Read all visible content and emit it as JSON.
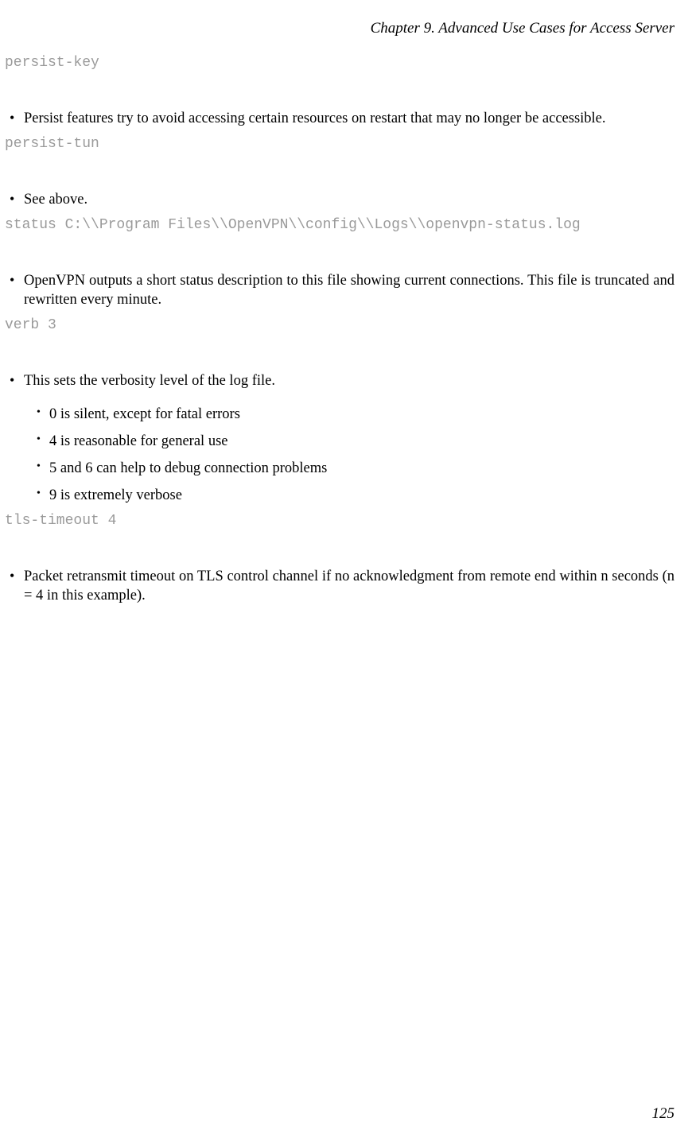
{
  "header": "Chapter 9. Advanced Use Cases for Access Server",
  "code_blocks": {
    "persist_key": "persist-key",
    "persist_tun": "persist-tun",
    "status": "status C:\\\\Program Files\\\\OpenVPN\\\\config\\\\Logs\\\\openvpn-status.log",
    "verb": "verb 3",
    "tls_timeout": "tls-timeout 4"
  },
  "bullets": {
    "persist_key": "Persist features try to avoid accessing certain resources on restart that may no longer be accessible.",
    "persist_tun": "See above.",
    "status": "OpenVPN outputs a short status description to this file showing current connections. This file is truncated and rewritten every minute.",
    "verb_intro": "This sets the verbosity level of the log file.",
    "verb_sub": {
      "a": "0 is silent, except for fatal errors",
      "b": "4 is reasonable for general use",
      "c": "5 and 6 can help to debug connection problems",
      "d": "9 is extremely verbose"
    },
    "tls_timeout": "Packet retransmit timeout on TLS control channel if no acknowledgment from remote end within n seconds (n = 4 in this example)."
  },
  "page_number": "125"
}
